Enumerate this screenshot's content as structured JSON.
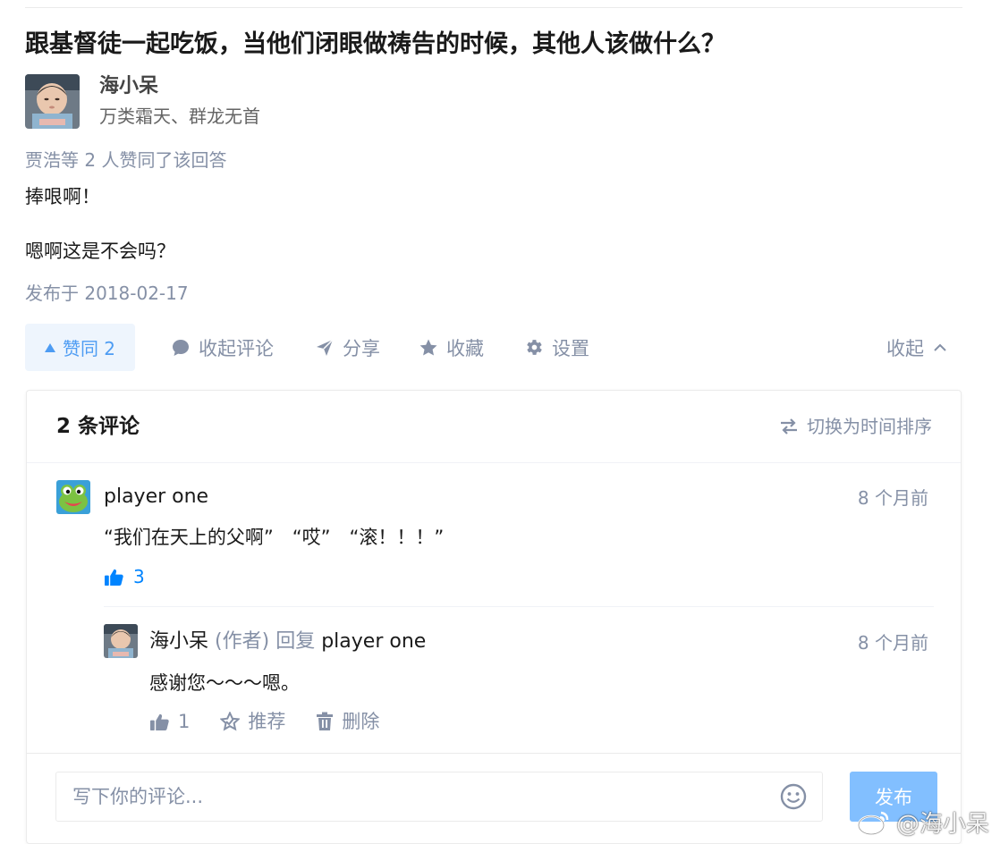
{
  "question": {
    "title": "跟基督徒一起吃饭，当他们闭眼做祷告的时候，其他人该做什么？"
  },
  "answer": {
    "author_name": "海小呆",
    "author_bio": "万类霜天、群龙无首",
    "voters_text": "贾浩等 2 人赞同了该回答",
    "paragraphs": [
      "捧哏啊！",
      "嗯啊这是不会吗？"
    ],
    "published": "发布于 2018-02-17"
  },
  "actions": {
    "vote_label": "赞同 2",
    "collapse_comments": "收起评论",
    "share": "分享",
    "favorite": "收藏",
    "settings": "设置",
    "collapse": "收起"
  },
  "comments": {
    "count_label": "2 条评论",
    "sort_label": "切换为时间排序",
    "items": [
      {
        "author": "player one",
        "time": "8 个月前",
        "text": "“我们在天上的父啊”　“哎”　“滚！！！”",
        "likes": "3"
      },
      {
        "author": "海小呆",
        "author_tag": "(作者)",
        "reply_word": "回复",
        "reply_to": "player one",
        "time": "8 个月前",
        "text": "感谢您～～～嗯。",
        "likes": "1",
        "recommend": "推荐",
        "delete": "删除"
      }
    ],
    "input_placeholder": "写下你的评论...",
    "submit_label": "发布"
  },
  "watermark": {
    "text": "@海小呆"
  },
  "colors": {
    "primary": "#0084ff",
    "vote_bg": "#eef5fd",
    "muted": "#8590a6",
    "submit_disabled": "#82bfff"
  }
}
